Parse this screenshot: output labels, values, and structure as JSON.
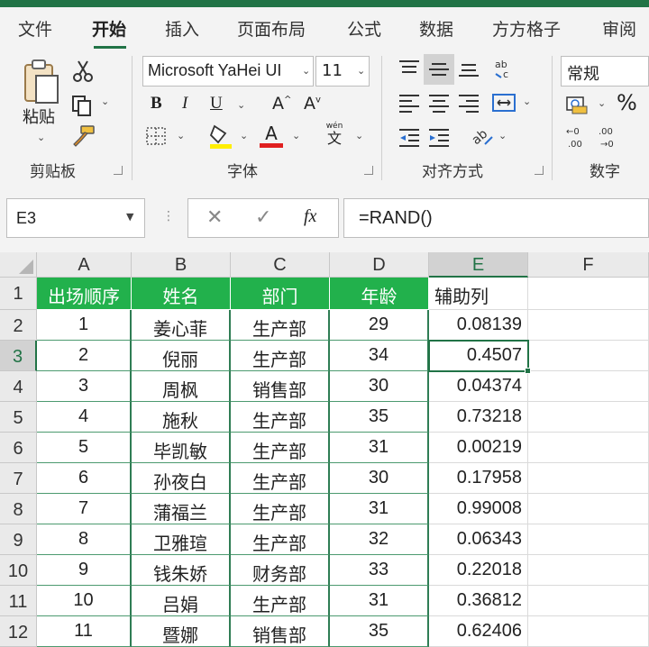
{
  "tabs": [
    {
      "label": "文件"
    },
    {
      "label": "开始",
      "active": true
    },
    {
      "label": "插入"
    },
    {
      "label": "页面布局"
    },
    {
      "label": "公式"
    },
    {
      "label": "数据"
    },
    {
      "label": "方方格子"
    },
    {
      "label": "审阅"
    }
  ],
  "ribbon": {
    "clipboard": {
      "paste_label": "粘贴",
      "group_label": "剪贴板"
    },
    "font": {
      "font_name": "Microsoft YaHei UI",
      "font_size": "11",
      "bold": "B",
      "italic": "I",
      "underline": "U",
      "grow": "A",
      "shrink": "A",
      "wen_label": "wén",
      "wen_char": "文",
      "font_color": "A",
      "group_label": "字体"
    },
    "alignment": {
      "group_label": "对齐方式"
    },
    "number": {
      "format": "常规",
      "percent": "%",
      "group_label": "数字"
    }
  },
  "formula_bar": {
    "name_box": "E3",
    "fx": "fx",
    "formula": "=RAND()"
  },
  "colors": {
    "accent": "#217346",
    "header_fill": "#22b14c",
    "border_green": "#2f7d54"
  },
  "sheet": {
    "columns": [
      "A",
      "B",
      "C",
      "D",
      "E",
      "F"
    ],
    "row_numbers": [
      "1",
      "2",
      "3",
      "4",
      "5",
      "6",
      "7",
      "8",
      "9",
      "10",
      "11",
      "12"
    ],
    "headers": [
      "出场顺序",
      "姓名",
      "部门",
      "年龄",
      "辅助列"
    ],
    "rows": [
      [
        "1",
        "姜心菲",
        "生产部",
        "29",
        "0.08139"
      ],
      [
        "2",
        "倪丽",
        "生产部",
        "34",
        "0.4507"
      ],
      [
        "3",
        "周枫",
        "销售部",
        "30",
        "0.04374"
      ],
      [
        "4",
        "施秋",
        "生产部",
        "35",
        "0.73218"
      ],
      [
        "5",
        "毕凯敏",
        "生产部",
        "31",
        "0.00219"
      ],
      [
        "6",
        "孙夜白",
        "生产部",
        "30",
        "0.17958"
      ],
      [
        "7",
        "蒲福兰",
        "生产部",
        "31",
        "0.99008"
      ],
      [
        "8",
        "卫雅瑄",
        "生产部",
        "32",
        "0.06343"
      ],
      [
        "9",
        "钱朱娇",
        "财务部",
        "33",
        "0.22018"
      ],
      [
        "10",
        "吕娟",
        "生产部",
        "31",
        "0.36812"
      ],
      [
        "11",
        "暨娜",
        "销售部",
        "35",
        "0.62406"
      ]
    ],
    "selected_cell": "E3"
  }
}
